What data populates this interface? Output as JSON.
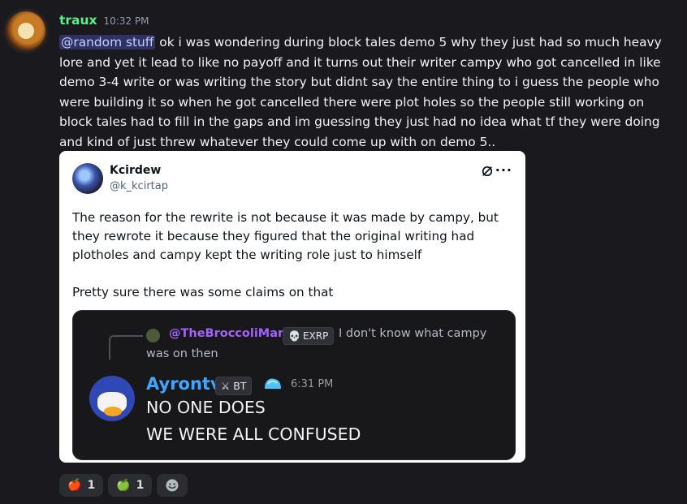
{
  "header": {
    "username": "traux",
    "time": "10:32 PM"
  },
  "message": {
    "mention": "@random stuff",
    "text": " ok i was wondering during block tales demo 5 why they just had so much heavy lore and yet it lead to like no payoff and it turns out their writer campy who got cancelled in like demo 3-4 write or was writing the story but didnt say the entire thing to i guess the people who were building it so when he got cancelled there were plot holes so the people still working on block tales had to fill in the gaps and im guessing they just had no idea what tf they were doing and kind of just threw whatever they could come up with on demo 5.."
  },
  "embed": {
    "author_name": "Kcirdew",
    "handle": "@k_kcirtap",
    "text": "The reason for the rewrite is not because it was made by campy, but they rewrote it because they figured that the original writing had plotholes and campy kept the writing role just to himself\n\nPretty sure there was some claims on that",
    "inner": {
      "reply_user": "@TheBroccoliMan",
      "reply_tag": "EXRP",
      "reply_text_1": "I don't know what campy",
      "reply_text_2": "was on then",
      "author": "Ayrontv",
      "author_tag": "BT",
      "time": "6:31 PM",
      "line1": "NO ONE DOES",
      "line2": "WE WERE ALL CONFUSED"
    }
  },
  "reactions": [
    {
      "emoji": "🍎",
      "count": "1"
    },
    {
      "emoji": "🍏",
      "count": "1"
    }
  ],
  "icons": [
    "link-icon",
    "more-icon",
    "smile-icon"
  ]
}
